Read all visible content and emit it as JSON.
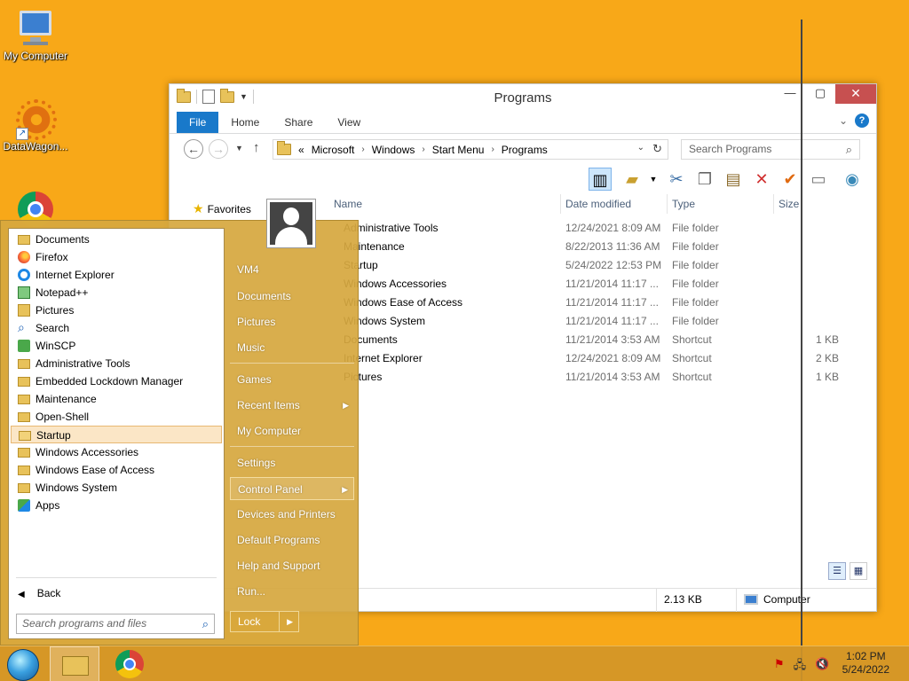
{
  "desktop": {
    "icons": [
      {
        "label": "My Computer"
      },
      {
        "label": "DataWagon..."
      },
      {
        "label": ""
      }
    ]
  },
  "explorer": {
    "title": "Programs",
    "ribbon_tabs": [
      "File",
      "Home",
      "Share",
      "View"
    ],
    "help_label": "?",
    "address": [
      "«",
      "Microsoft",
      "Windows",
      "Start Menu",
      "Programs"
    ],
    "search_placeholder": "Search Programs",
    "nav": {
      "favorites": "Favorites"
    },
    "columns": {
      "name": "Name",
      "date": "Date modified",
      "type": "Type",
      "size": "Size"
    },
    "rows": [
      {
        "name": "Administrative Tools",
        "date": "12/24/2021 8:09 AM",
        "type": "File folder",
        "size": ""
      },
      {
        "name": "Maintenance",
        "date": "8/22/2013 11:36 AM",
        "type": "File folder",
        "size": ""
      },
      {
        "name": "Startup",
        "date": "5/24/2022 12:53 PM",
        "type": "File folder",
        "size": ""
      },
      {
        "name": "Windows Accessories",
        "date": "11/21/2014 11:17 ...",
        "type": "File folder",
        "size": ""
      },
      {
        "name": "Windows Ease of Access",
        "date": "11/21/2014 11:17 ...",
        "type": "File folder",
        "size": ""
      },
      {
        "name": "Windows System",
        "date": "11/21/2014 11:17 ...",
        "type": "File folder",
        "size": ""
      },
      {
        "name": "Documents",
        "date": "11/21/2014 3:53 AM",
        "type": "Shortcut",
        "size": "1 KB"
      },
      {
        "name": "Internet Explorer",
        "date": "12/24/2021 8:09 AM",
        "type": "Shortcut",
        "size": "2 KB"
      },
      {
        "name": "Pictures",
        "date": "11/21/2014 3:53 AM",
        "type": "Shortcut",
        "size": "1 KB"
      }
    ],
    "status": {
      "size": "2.13 KB",
      "location": "Computer"
    }
  },
  "start_menu": {
    "programs": [
      {
        "label": "Documents",
        "icon": "folder-icon"
      },
      {
        "label": "Firefox",
        "icon": "firefox-icon"
      },
      {
        "label": "Internet Explorer",
        "icon": "internet-explorer-icon"
      },
      {
        "label": "Notepad++",
        "icon": "notepad-plus-plus-icon"
      },
      {
        "label": "Pictures",
        "icon": "pictures-icon"
      },
      {
        "label": "Search",
        "icon": "search-icon"
      },
      {
        "label": "WinSCP",
        "icon": "winscp-icon"
      },
      {
        "label": "Administrative Tools",
        "icon": "folder-icon"
      },
      {
        "label": "Embedded Lockdown Manager",
        "icon": "folder-icon"
      },
      {
        "label": "Maintenance",
        "icon": "folder-icon"
      },
      {
        "label": "Open-Shell",
        "icon": "folder-icon"
      },
      {
        "label": "Startup",
        "icon": "folder-open-icon",
        "selected": true
      },
      {
        "label": "Windows Accessories",
        "icon": "folder-icon"
      },
      {
        "label": "Windows Ease of Access",
        "icon": "folder-icon"
      },
      {
        "label": "Windows System",
        "icon": "folder-icon"
      },
      {
        "label": "Apps",
        "icon": "apps-icon"
      }
    ],
    "back_label": "Back",
    "search_placeholder": "Search programs and files",
    "right_items": [
      {
        "label": "VM4"
      },
      {
        "label": "Documents"
      },
      {
        "label": "Pictures"
      },
      {
        "label": "Music"
      },
      {
        "label": "Games"
      },
      {
        "label": "Recent Items",
        "submenu": true
      },
      {
        "label": "My Computer"
      },
      {
        "label": "Settings"
      },
      {
        "label": "Control Panel",
        "submenu": true,
        "highlighted": true
      },
      {
        "label": "Devices and Printers"
      },
      {
        "label": "Default Programs"
      },
      {
        "label": "Help and Support"
      },
      {
        "label": "Run..."
      }
    ],
    "lock_label": "Lock"
  },
  "taskbar": {
    "clock_time": "1:02 PM",
    "clock_date": "5/24/2022"
  }
}
